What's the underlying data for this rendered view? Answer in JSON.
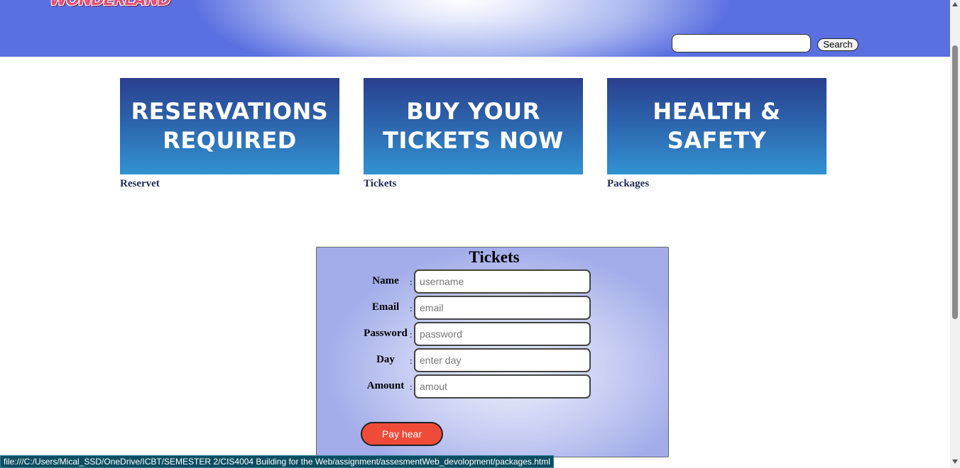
{
  "header": {
    "logo_text": "WONDERLAND",
    "search": {
      "value": "",
      "placeholder": "",
      "button_label": "Search"
    }
  },
  "cards": [
    {
      "banner_line1": "RESERVATIONS",
      "banner_line2": "REQUIRED",
      "link_label": "Reservet"
    },
    {
      "banner_line1": "BUY YOUR",
      "banner_line2": "TICKETS NOW",
      "link_label": "Tickets"
    },
    {
      "banner_line1": "HEALTH &",
      "banner_line2": "SAFETY",
      "link_label": "Packages"
    }
  ],
  "form": {
    "title": "Tickets",
    "colon": ":",
    "fields": [
      {
        "label": "Name",
        "placeholder": "username"
      },
      {
        "label": "Email",
        "placeholder": "email"
      },
      {
        "label": "Password",
        "placeholder": "password"
      },
      {
        "label": "Day",
        "placeholder": "enter day"
      },
      {
        "label": "Amount",
        "placeholder": "amout"
      }
    ],
    "submit_label": "Pay hear"
  },
  "status_bar": {
    "url": "file:///C:/Users/Mical_SSD/OneDrive/ICBT/SEMESTER 2/CIS4004 Building for the Web/assignment/assesmentWeb_devolopment/packages.html"
  },
  "colors": {
    "banner_top": "#2a3f8e",
    "banner_bottom": "#3292d1",
    "submit_button": "#f04b38",
    "status_bar": "#0d4e63",
    "header_edge": "#5a6fe0"
  }
}
